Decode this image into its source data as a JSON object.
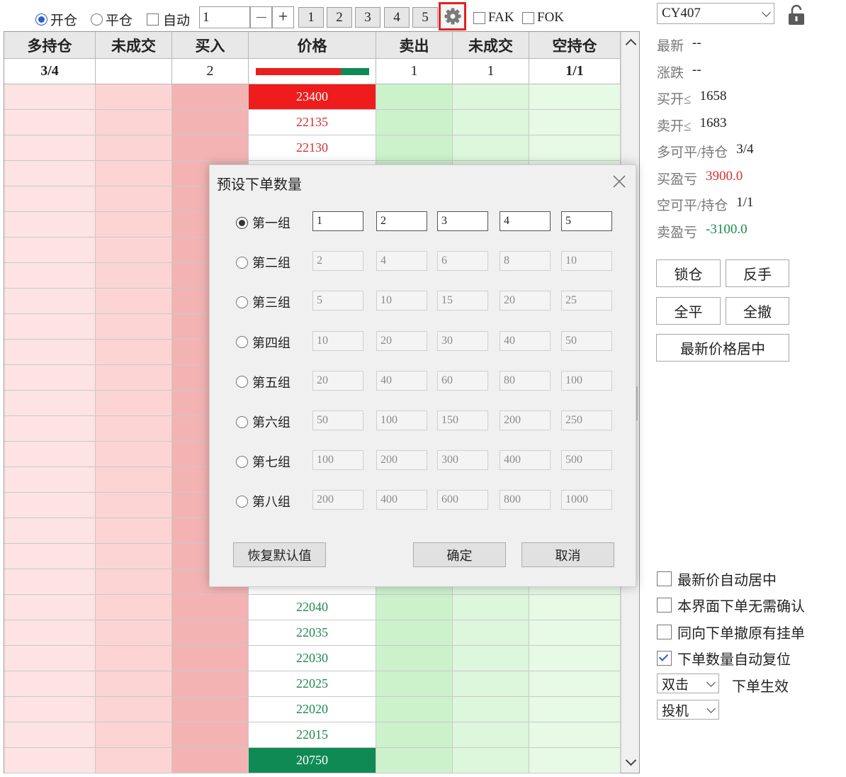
{
  "toolbar": {
    "open_label": "开仓",
    "close_label": "平仓",
    "auto_label": "自动",
    "qty_value": "1",
    "minus": "—",
    "plus": "+",
    "presets": [
      "1",
      "2",
      "3",
      "4",
      "5"
    ],
    "fak_label": "FAK",
    "fok_label": "FOK"
  },
  "table": {
    "headers": [
      "多持仓",
      "未成交",
      "买入",
      "价格",
      "卖出",
      "未成交",
      "空持仓"
    ],
    "summary": {
      "long_pos": "3/4",
      "unfilled_buy": "",
      "buy": "2",
      "sell": "1",
      "unfilled_sell": "1",
      "short_pos": "1/1"
    },
    "top_prices": [
      "23400",
      "22135",
      "22130"
    ],
    "bottom_prices": [
      "22040",
      "22035",
      "22030",
      "22025",
      "22020",
      "22015",
      "20750"
    ]
  },
  "right_panel": {
    "contract": "CY407",
    "rows": [
      {
        "label": "最新",
        "value": "--"
      },
      {
        "label": "涨跌",
        "value": "--"
      },
      {
        "label": "买开≤",
        "value": "1658"
      },
      {
        "label": "卖开≤",
        "value": "1683"
      },
      {
        "label": "多可平/持仓",
        "value": "3/4"
      },
      {
        "label": "买盈亏",
        "value": "3900.0"
      },
      {
        "label": "空可平/持仓",
        "value": "1/1"
      },
      {
        "label": "卖盈亏",
        "value": "-3100.0"
      }
    ],
    "lock_btn": "锁仓",
    "reverse_btn": "反手",
    "close_all_btn": "全平",
    "cancel_all_btn": "全撤",
    "center_btn": "最新价格居中",
    "checks": [
      {
        "label": "最新价自动居中",
        "checked": false
      },
      {
        "label": "本界面下单无需确认",
        "checked": false
      },
      {
        "label": "同向下单撤原有挂单",
        "checked": false
      },
      {
        "label": "下单数量自动复位",
        "checked": true
      }
    ],
    "click_mode": "双击",
    "click_mode_label": "下单生效",
    "hedge_mode": "投机"
  },
  "dialog": {
    "title": "预设下单数量",
    "groups": [
      {
        "label": "第一组",
        "values": [
          "1",
          "2",
          "3",
          "4",
          "5"
        ],
        "selected": true
      },
      {
        "label": "第二组",
        "values": [
          "2",
          "4",
          "6",
          "8",
          "10"
        ],
        "selected": false
      },
      {
        "label": "第三组",
        "values": [
          "5",
          "10",
          "15",
          "20",
          "25"
        ],
        "selected": false
      },
      {
        "label": "第四组",
        "values": [
          "10",
          "20",
          "30",
          "40",
          "50"
        ],
        "selected": false
      },
      {
        "label": "第五组",
        "values": [
          "20",
          "40",
          "60",
          "80",
          "100"
        ],
        "selected": false
      },
      {
        "label": "第六组",
        "values": [
          "50",
          "100",
          "150",
          "200",
          "250"
        ],
        "selected": false
      },
      {
        "label": "第七组",
        "values": [
          "100",
          "200",
          "300",
          "400",
          "500"
        ],
        "selected": false
      },
      {
        "label": "第八组",
        "values": [
          "200",
          "400",
          "600",
          "800",
          "1000"
        ],
        "selected": false
      }
    ],
    "restore_btn": "恢复默认值",
    "ok_btn": "确定",
    "cancel_btn": "取消"
  },
  "colors": {
    "accent": "#2a5fc7",
    "up_price": "#d83030",
    "down_price": "#1e8a4e",
    "price_high_bg": "#ee1c1c",
    "price_low_bg": "#108a55",
    "profit": "#d83030",
    "loss": "#1e8a4e",
    "gear_highlight": "#e52020"
  }
}
